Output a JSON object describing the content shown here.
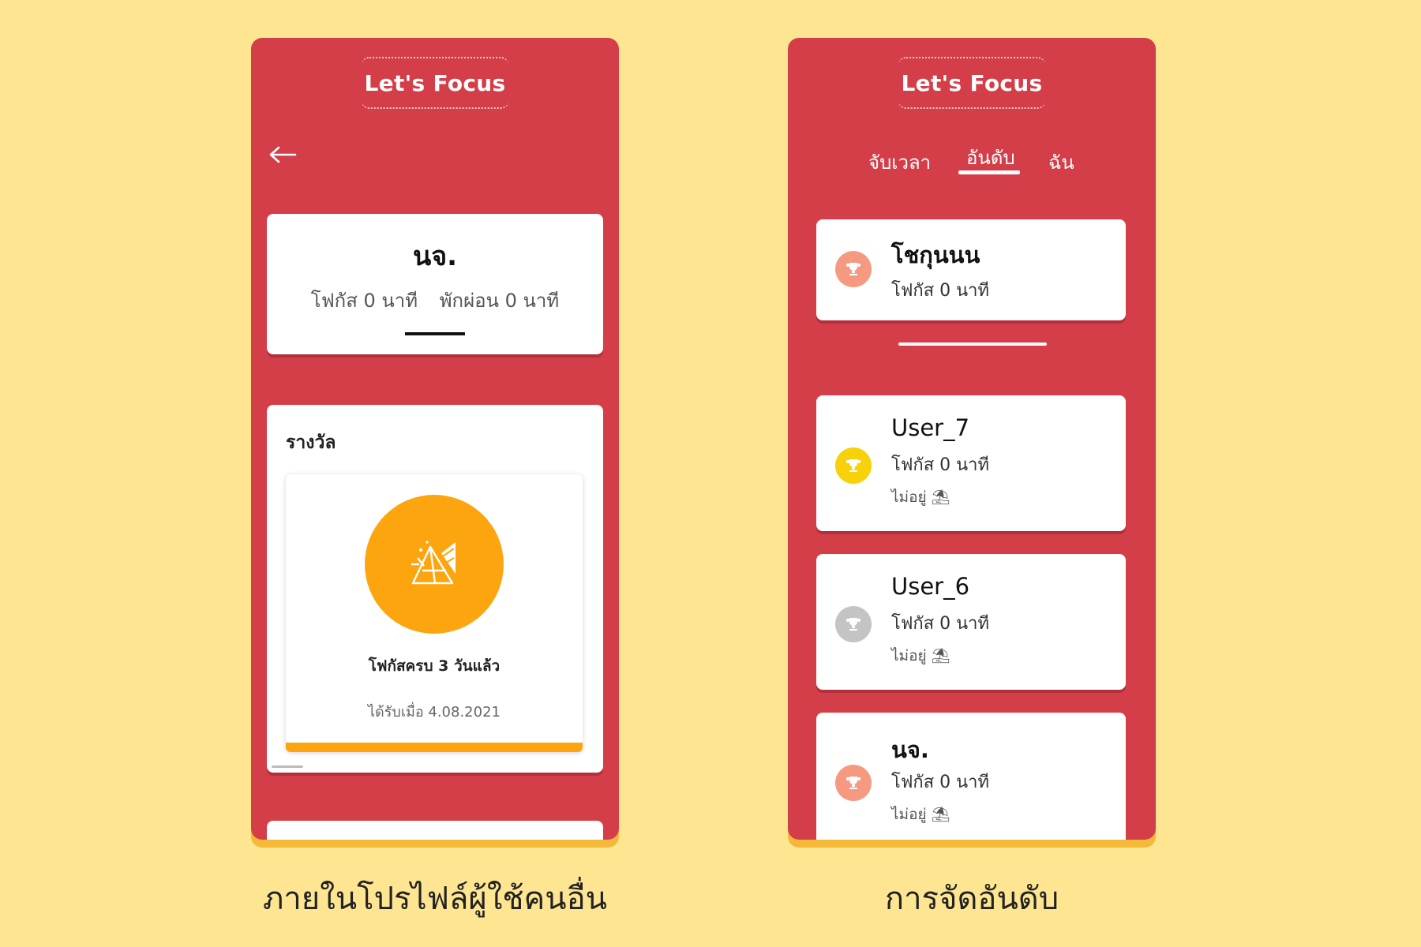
{
  "colors": {
    "background": "#fde591",
    "panel": "#d33e49",
    "accent_orange": "#fda50f",
    "panel_shadow": "#f5b93a",
    "trophy_bronze": "#f59a80",
    "trophy_gold": "#f7d20a",
    "trophy_silver": "#c4c4c4"
  },
  "left_screen": {
    "app_title": "Let's Focus",
    "back_icon": "back-arrow-icon",
    "profile": {
      "name": "นจ.",
      "focus": "โฟกัส 0 นาที",
      "rest": "พักผ่อน 0 นาที"
    },
    "awards": {
      "title": "รางวัล",
      "items": [
        {
          "icon": "prism-tent-icon",
          "name": "โฟกัสครบ 3 วันแล้ว",
          "date": "ได้รับเมื่อ 4.08.2021"
        }
      ]
    },
    "caption": "ภายในโปรไฟล์ผู้ใช้คนอื่น"
  },
  "right_screen": {
    "app_title": "Let's Focus",
    "tabs": [
      {
        "label": "จับเวลา",
        "active": false
      },
      {
        "label": "อันดับ",
        "active": true
      },
      {
        "label": "ฉัน",
        "active": false
      }
    ],
    "me": {
      "name": "โชกุนนน",
      "focus": "โฟกัส 0 นาที",
      "trophy": "bronze"
    },
    "ranking": [
      {
        "name": "User_7",
        "focus": "โฟกัส 0 นาที",
        "status": "ไม่อยู่ ⛱",
        "trophy": "gold"
      },
      {
        "name": "User_6",
        "focus": "โฟกัส 0 นาที",
        "status": "ไม่อยู่ ⛱",
        "trophy": "silver"
      },
      {
        "name": "นจ.",
        "focus": "โฟกัส 0 นาที",
        "status": "ไม่อยู่ ⛱",
        "trophy": "bronze"
      }
    ],
    "caption": "การจัดอันดับ"
  }
}
